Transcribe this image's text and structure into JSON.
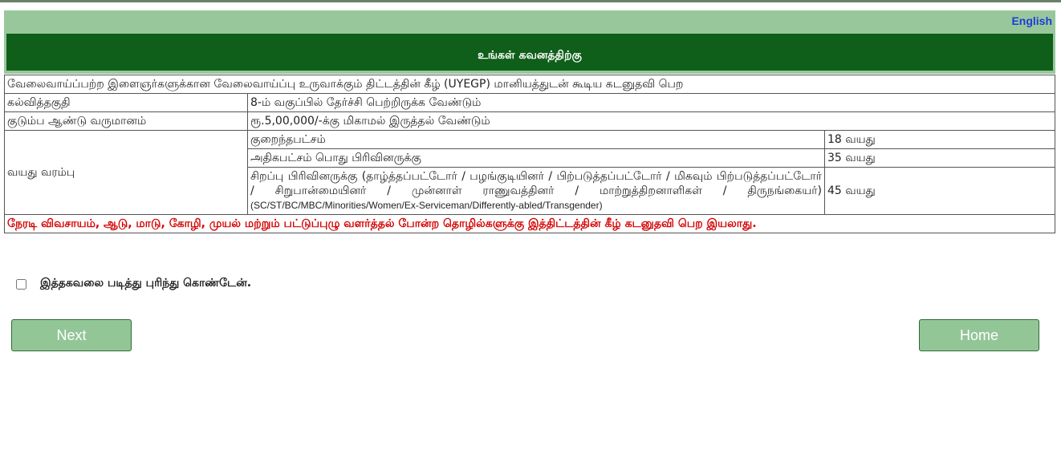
{
  "header": {
    "language_link": "English",
    "title": "உங்கள் கவனத்திற்கு"
  },
  "table": {
    "heading": "வேலைவாய்ப்பற்ற இளைஞர்களுக்கான வேலைவாய்ப்பு உருவாக்கும் திட்டத்தின் கீழ் (UYEGP) மானியத்துடன் கூடிய கடனுதவி பெற",
    "education_label": "கல்வித்தகுதி",
    "education_value": "8-ம் வகுப்பில் தேர்ச்சி பெற்றிருக்க வேண்டும்",
    "income_label": "குடும்ப ஆண்டு வருமானம்",
    "income_value": "ரூ.5,00,000/-க்கு மிகாமல் இருத்தல் வேண்டும்",
    "age_label": "வயது வரம்பு",
    "age_rows": [
      {
        "label": "குறைந்தபட்சம்",
        "value": "18 வயது"
      },
      {
        "label": "அதிகபட்சம் பொது பிரிவினருக்கு",
        "value": "35 வயது"
      },
      {
        "label": "சிறப்பு பிரிவினருக்கு (தாழ்த்தப்பட்டோர் / பழங்குடியினர் / பிற்படுத்தப்பட்டோர் / மிகவும் பிற்படுத்தப்பட்டோர் / சிறுபான்மையினர் / முன்னாள் ராணுவத்தினர் / மாற்றுத்திறனாளிகள் / திருநங்கையர்)",
        "label_en": "(SC/ST/BC/MBC/Minorities/Women/Ex-Serviceman/Differently-abled/Transgender)",
        "value": "45 வயது"
      }
    ],
    "warning": "நேரடி விவசாயம், ஆடு, மாடு, கோழி, முயல் மற்றும் பட்டுப்புழு வளர்த்தல் போன்ற தொழில்களுக்கு இத்திட்டத்தின் கீழ் கடனுதவி பெற இயலாது."
  },
  "agreement": {
    "checked": false,
    "label": "இத்தகவலை படித்து புரிந்து கொண்டேன்."
  },
  "buttons": {
    "next": "Next",
    "home": "Home"
  },
  "colors": {
    "header_band": "#99c79c",
    "title_bar": "#0f5e19",
    "button": "#93c697",
    "warning": "#d40000",
    "link": "#1a3fd6"
  }
}
